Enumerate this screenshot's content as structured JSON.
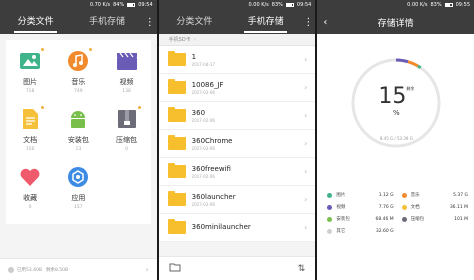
{
  "status": [
    {
      "net": "0.70 K/s",
      "batt": "84%",
      "time": "09:54"
    },
    {
      "net": "0.00 K/s",
      "batt": "83%",
      "time": "09:54"
    },
    {
      "net": "0.00 K/s",
      "batt": "83%",
      "time": "09:55"
    }
  ],
  "tabs": {
    "categories": "分类文件",
    "storage": "手机存储"
  },
  "categories": [
    {
      "label": "图片",
      "count": "718",
      "icon": "image-icon",
      "color": "#3fb389"
    },
    {
      "label": "音乐",
      "count": "749",
      "icon": "music-icon",
      "color": "#f08a2c"
    },
    {
      "label": "视频",
      "count": "138",
      "icon": "video-icon",
      "color": "#6a5bb7"
    },
    {
      "label": "文档",
      "count": "156",
      "icon": "document-icon",
      "color": "#f5c03a"
    },
    {
      "label": "安装包",
      "count": "13",
      "icon": "android-icon",
      "color": "#79bf4b"
    },
    {
      "label": "压缩包",
      "count": "0",
      "icon": "archive-icon",
      "color": "#6c6c78"
    },
    {
      "label": "收藏",
      "count": "0",
      "icon": "heart-icon",
      "color": "#ef5a6d"
    },
    {
      "label": "应用",
      "count": "157",
      "icon": "apps-icon",
      "color": "#3d8be5"
    }
  ],
  "footer_storage": {
    "used": "已用53.40B",
    "free": "剩余8.50B"
  },
  "breadcrumb": "手机SD卡",
  "folders": [
    {
      "name": "1",
      "date": "2017-04-17"
    },
    {
      "name": "10086_JF",
      "date": "2017-02-06"
    },
    {
      "name": "360",
      "date": "2017-02-06"
    },
    {
      "name": "360Chrome",
      "date": "2017-02-06"
    },
    {
      "name": "360freewifi",
      "date": "2017-02-06"
    },
    {
      "name": "360launcher",
      "date": "2017-02-06"
    },
    {
      "name": "360minilauncher",
      "date": ""
    }
  ],
  "detail": {
    "title": "存储详情",
    "percent": "15",
    "percent_unit": "%",
    "percent_label": "剩余",
    "used_text": "8.45 G / 53.39 G",
    "percent_value": 15
  },
  "legend": [
    {
      "name": "图片",
      "value": "1.12 G",
      "color": "#3fb389"
    },
    {
      "name": "音乐",
      "value": "5.37 G",
      "color": "#f08a2c"
    },
    {
      "name": "视频",
      "value": "7.76 G",
      "color": "#6a5bb7"
    },
    {
      "name": "文档",
      "value": "36.11 M",
      "color": "#f5c03a"
    },
    {
      "name": "安装包",
      "value": "68.46 M",
      "color": "#79bf4b"
    },
    {
      "name": "压缩包",
      "value": "101 M",
      "color": "#6c6c78"
    },
    {
      "name": "其它",
      "value": "32.60 G",
      "color": "#cfcfcf"
    }
  ]
}
